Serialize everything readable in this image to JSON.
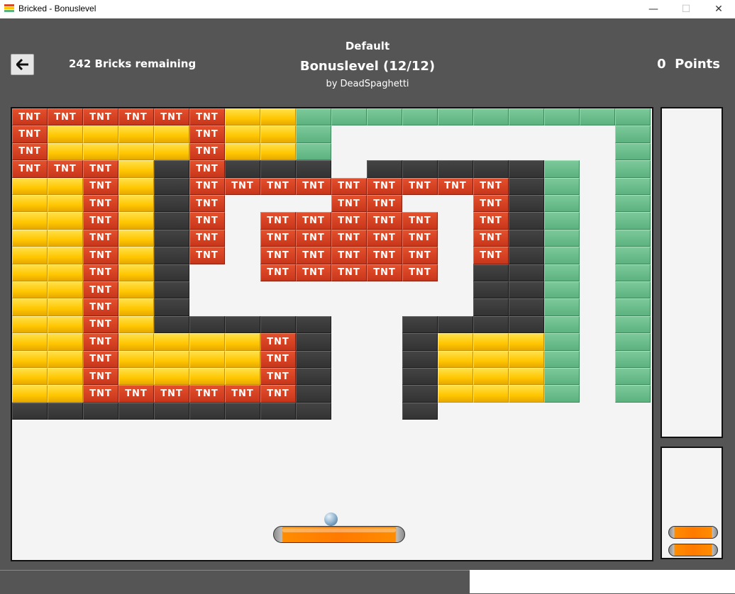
{
  "window": {
    "title": "Bricked - Bonuslevel",
    "minimize_glyph": "—",
    "maximize_glyph": "☐",
    "close_glyph": "✕"
  },
  "header": {
    "back_icon": "arrow-left-icon",
    "back_glyph": "🡐",
    "bricks_remaining": "242 Bricks remaining",
    "pack_name": "Default",
    "level_name": "Bonuslevel (12/12)",
    "author": "by DeadSpaghetti",
    "points": "0  Points"
  },
  "game": {
    "tnt_label": "TNT",
    "legend": {
      "T": "tnt",
      "Y": "yellow",
      "G": "green",
      "D": "dark",
      ".": "empty"
    },
    "grid": [
      "TTTTTTYYGGGGGGGGGG",
      "TYYYYTYYG........G",
      "TYYYYTYYG........G",
      "TTTYDTDDD.DDDDDG.G",
      "YYTYDTTTTTTTTTDG.G",
      "YYTYDT...TT..TDG.G",
      "YYTYDT.TTTTT.TDG.G",
      "YYTYDT.TTTTT.TDG.G",
      "YYTYDT.TTTTT.TDG.G",
      "YYTYD..TTTTT.DDG.G",
      "YYTYD........DDG.G",
      "YYTYD........DDG.G",
      "YYTYDDDDD..DDDDG.G",
      "YYTYYYYTD..DYYYG.G",
      "YYTYYYYTD..DYYYG.G",
      "YYTYYYYTD..DYYYG.G",
      "YYTTTTTTD..DYYYG.G",
      "DDDDDDDDD..D......"
    ],
    "lives_remaining": 2,
    "colors": {
      "background": "#555555",
      "field": "#f4f4f4",
      "paddle": "#ff7a00"
    }
  }
}
